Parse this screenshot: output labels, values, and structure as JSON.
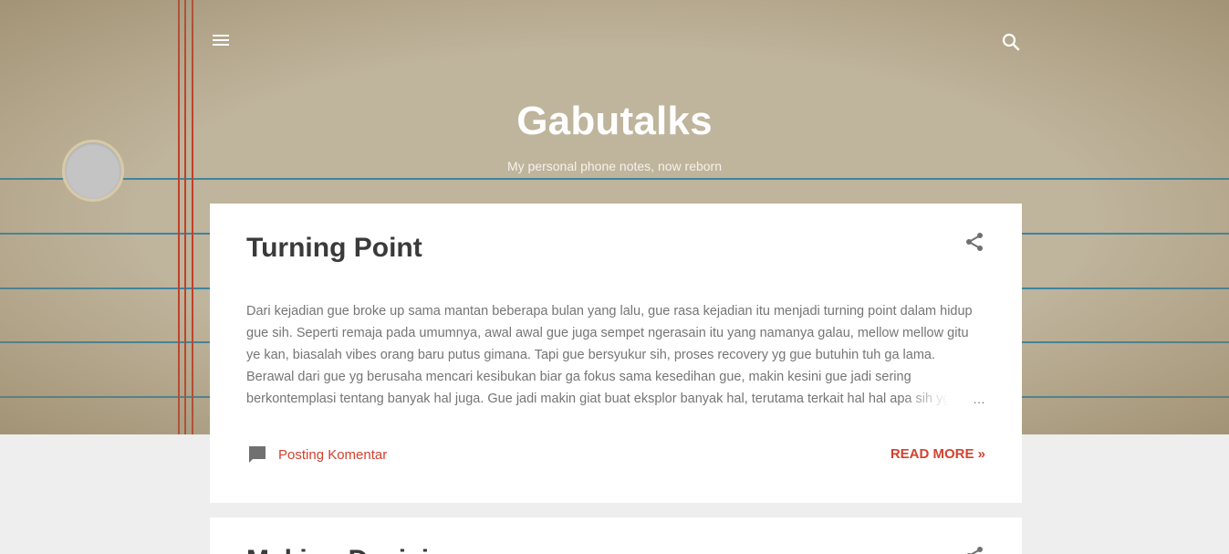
{
  "header": {
    "title": "Gabutalks",
    "description": "My personal phone notes, now reborn",
    "menu_icon": "menu-icon",
    "search_icon": "search-icon"
  },
  "posts": [
    {
      "title": "Turning Point",
      "snippet": "Dari kejadian gue broke up sama mantan beberapa bulan yang lalu, gue rasa kejadian itu menjadi turning point dalam hidup gue sih. Seperti remaja pada umumnya, awal awal gue juga sempet ngerasain itu yang namanya galau, mellow mellow gitu ye kan, biasalah vibes orang baru putus gimana. Tapi gue bersyukur sih, proses recovery yg gue butuhin tuh ga lama. Berawal dari gue yg berusaha mencari kesibukan biar ga fokus sama kesedihan gue, makin kesini gue jadi sering berkontemplasi tentang banyak hal juga. Gue jadi makin giat buat eksplor banyak hal, terutama terkait hal hal apa sih yg",
      "ellipsis": "…",
      "comment_label": "Posting Komentar",
      "read_more": "READ MORE »",
      "share_icon": "share-icon",
      "comment_icon": "comment-icon"
    },
    {
      "title": "Making Decisions",
      "share_icon": "share-icon"
    }
  ],
  "colors": {
    "accent": "#d3412f",
    "hero_bg": "#bfb49c",
    "page_bg": "#eeeeee",
    "rule_line": "#2f7f9e",
    "margin_line": "#c0402a"
  }
}
